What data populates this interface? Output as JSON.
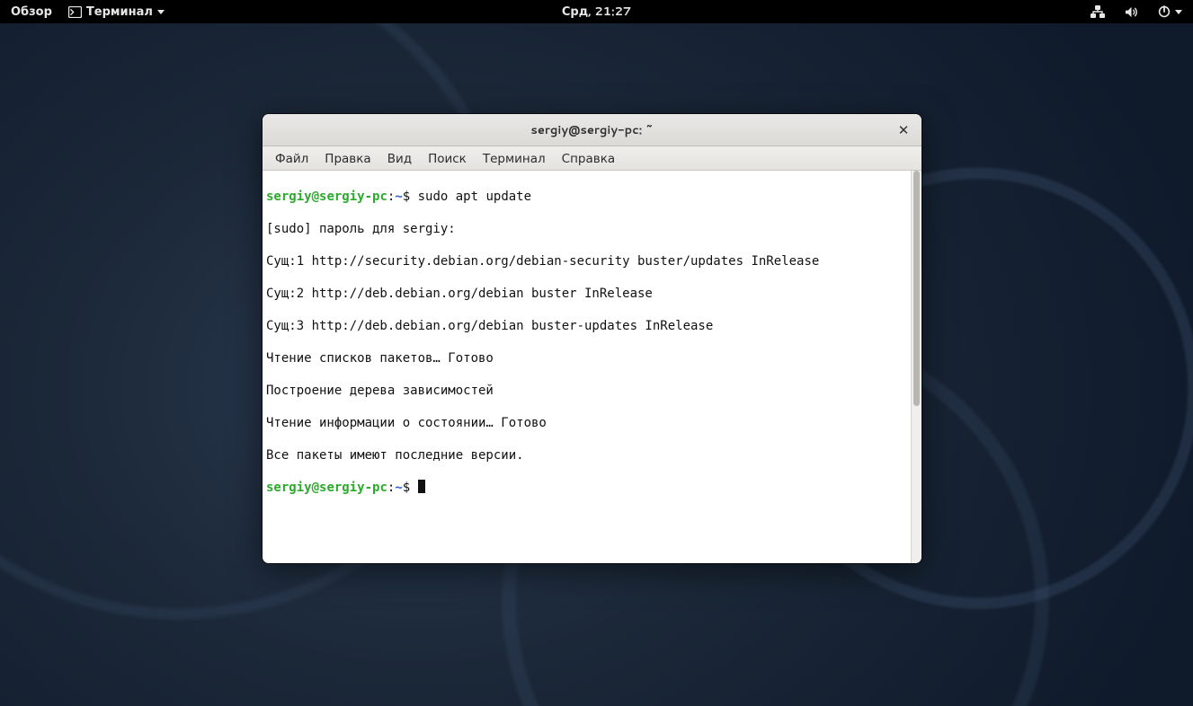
{
  "panel": {
    "activities": "Обзор",
    "app_name": "Терминал",
    "clock": "Срд, 21:27"
  },
  "window": {
    "title": "sergiy@sergiy-pc: ~"
  },
  "menubar": {
    "file": "Файл",
    "edit": "Правка",
    "view": "Вид",
    "search": "Поиск",
    "terminal": "Терминал",
    "help": "Справка"
  },
  "prompt": {
    "user": "sergiy",
    "at": "@",
    "host": "sergiy-pc",
    "colon": ":",
    "path": "~",
    "dollar": "$ "
  },
  "terminal": {
    "cmd1": "sudo apt update",
    "line_sudo": "[sudo] пароль для sergiy:",
    "line_hit1": "Сущ:1 http://security.debian.org/debian-security buster/updates InRelease",
    "line_hit2": "Сущ:2 http://deb.debian.org/debian buster InRelease",
    "line_hit3": "Сущ:3 http://deb.debian.org/debian buster-updates InRelease",
    "line_read": "Чтение списков пакетов… Готово",
    "line_tree": "Построение дерева зависимостей",
    "line_state": "Чтение информации о состоянии… Готово",
    "line_all": "Все пакеты имеют последние версии."
  }
}
